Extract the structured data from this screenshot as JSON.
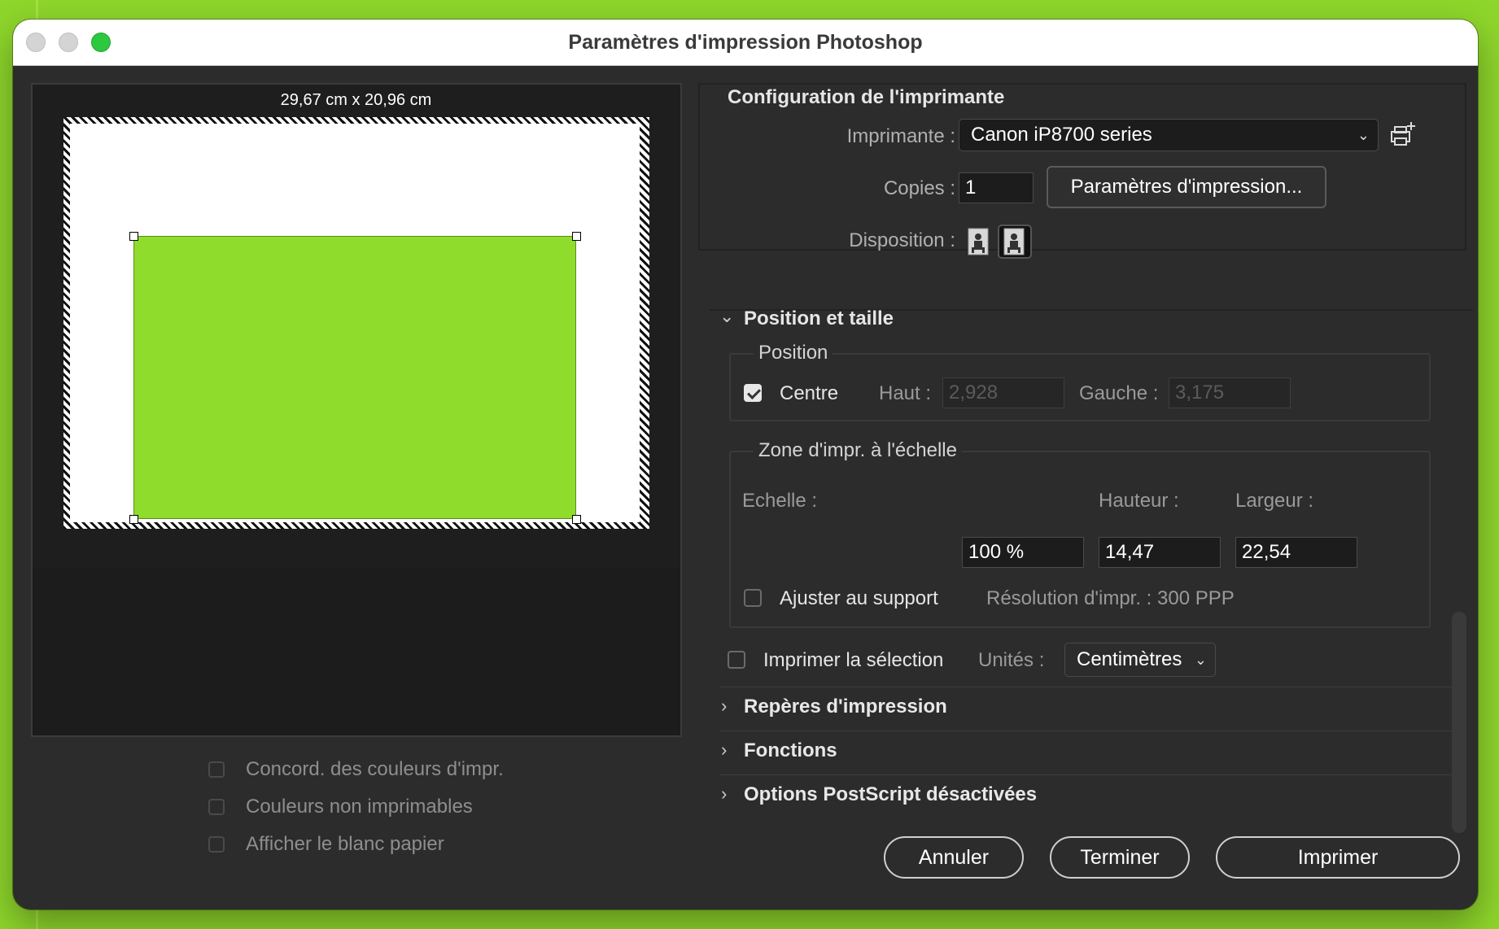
{
  "window": {
    "title": "Paramètres d'impression Photoshop"
  },
  "preview": {
    "dimensions": "29,67 cm x 20,96 cm",
    "image_color": "#8fdc2c",
    "options": [
      {
        "label": "Concord. des couleurs d'impr.",
        "checked": false
      },
      {
        "label": "Couleurs non imprimables",
        "checked": false
      },
      {
        "label": "Afficher le blanc papier",
        "checked": false
      }
    ]
  },
  "printer_setup": {
    "title": "Configuration de l'imprimante",
    "printer_label": "Imprimante :",
    "printer_value": "Canon iP8700 series",
    "copies_label": "Copies :",
    "copies_value": "1",
    "print_settings_button": "Paramètres d'impression...",
    "layout_label": "Disposition :"
  },
  "position_size": {
    "title": "Position et taille",
    "position_group": "Position",
    "center_label": "Centre",
    "center_checked": true,
    "top_label": "Haut :",
    "top_value": "2,928",
    "left_label": "Gauche :",
    "left_value": "3,175",
    "scaled_group": "Zone d'impr. à l'échelle",
    "scale_label": "Echelle :",
    "scale_value": "100 %",
    "height_label": "Hauteur :",
    "height_value": "14,47",
    "width_label": "Largeur :",
    "width_value": "22,54",
    "fit_media_label": "Ajuster au support",
    "fit_media_checked": false,
    "resolution_text": "Résolution d'impr. : 300 PPP",
    "print_selection_label": "Imprimer la sélection",
    "print_selection_checked": false,
    "units_label": "Unités :",
    "units_value": "Centimètres"
  },
  "sections": [
    {
      "label": "Repères d'impression"
    },
    {
      "label": "Fonctions"
    },
    {
      "label": "Options PostScript désactivées"
    }
  ],
  "buttons": {
    "cancel": "Annuler",
    "done": "Terminer",
    "print": "Imprimer"
  }
}
